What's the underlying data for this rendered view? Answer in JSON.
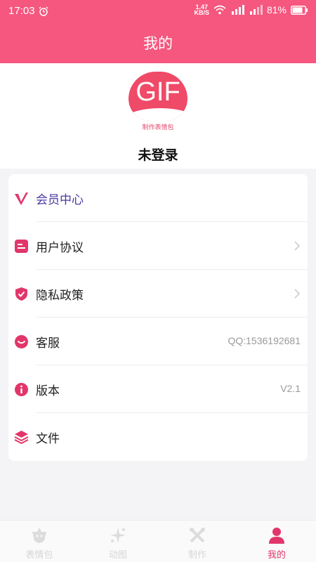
{
  "status_bar": {
    "time": "17:03",
    "speed_value": "1.47",
    "speed_unit": "KB/S",
    "battery": "81%"
  },
  "header": {
    "title": "我的"
  },
  "profile": {
    "logo_text": "GIF",
    "logo_subtitle": "制作表情包",
    "username": "未登录"
  },
  "menu": [
    {
      "icon": "vip-icon",
      "label": "会员中心",
      "value": "",
      "chevron": false
    },
    {
      "icon": "agreement-icon",
      "label": "用户协议",
      "value": "",
      "chevron": true
    },
    {
      "icon": "shield-icon",
      "label": "隐私政策",
      "value": "",
      "chevron": true
    },
    {
      "icon": "customer-service-icon",
      "label": "客服",
      "value": "QQ:1536192681",
      "chevron": false
    },
    {
      "icon": "info-icon",
      "label": "版本",
      "value": "V2.1",
      "chevron": false
    },
    {
      "icon": "layers-icon",
      "label": "文件",
      "value": "",
      "chevron": false
    }
  ],
  "tabs": [
    {
      "icon": "emoji-pack-icon",
      "label": "表情包",
      "active": false
    },
    {
      "icon": "sparkle-icon",
      "label": "动图",
      "active": false
    },
    {
      "icon": "tools-icon",
      "label": "制作",
      "active": false
    },
    {
      "icon": "person-icon",
      "label": "我的",
      "active": true
    }
  ],
  "colors": {
    "accent": "#f5577f",
    "accent_dark": "#e2366a",
    "vip_text": "#4a3aa2"
  }
}
